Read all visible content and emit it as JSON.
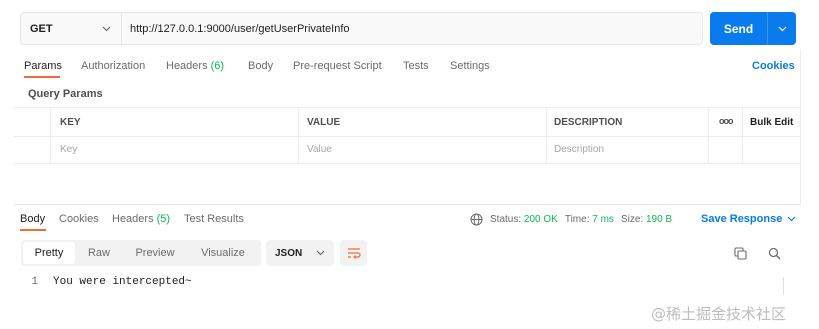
{
  "request": {
    "method": "GET",
    "url": "http://127.0.0.1:9000/user/getUserPrivateInfo",
    "send_label": "Send"
  },
  "request_tabs": [
    {
      "label": "Params",
      "active": true
    },
    {
      "label": "Authorization"
    },
    {
      "label": "Headers",
      "count": "(6)"
    },
    {
      "label": "Body"
    },
    {
      "label": "Pre-request Script"
    },
    {
      "label": "Tests"
    },
    {
      "label": "Settings"
    }
  ],
  "cookies_label": "Cookies",
  "query_params": {
    "title": "Query Params",
    "columns": [
      "KEY",
      "VALUE",
      "DESCRIPTION"
    ],
    "more_icon": "ooo",
    "bulk_edit_label": "Bulk Edit",
    "placeholders": {
      "key": "Key",
      "value": "Value",
      "description": "Description"
    }
  },
  "response_tabs": [
    {
      "label": "Body",
      "active": true
    },
    {
      "label": "Cookies"
    },
    {
      "label": "Headers",
      "count": "(5)"
    },
    {
      "label": "Test Results"
    }
  ],
  "status": {
    "status_label": "Status:",
    "status_value": "200 OK",
    "time_label": "Time:",
    "time_value": "7 ms",
    "size_label": "Size:",
    "size_value": "190 B"
  },
  "save_response_label": "Save Response",
  "view_modes": [
    "Pretty",
    "Raw",
    "Preview",
    "Visualize"
  ],
  "active_view_mode": "Pretty",
  "format": "JSON",
  "response_body": [
    {
      "line": "1",
      "text": "You were intercepted~"
    }
  ],
  "watermark": "@稀土掘金技术社区",
  "colors": {
    "accent": "#097bed",
    "active_tab": "#f26b3a",
    "status_ok": "#0cbb52"
  }
}
